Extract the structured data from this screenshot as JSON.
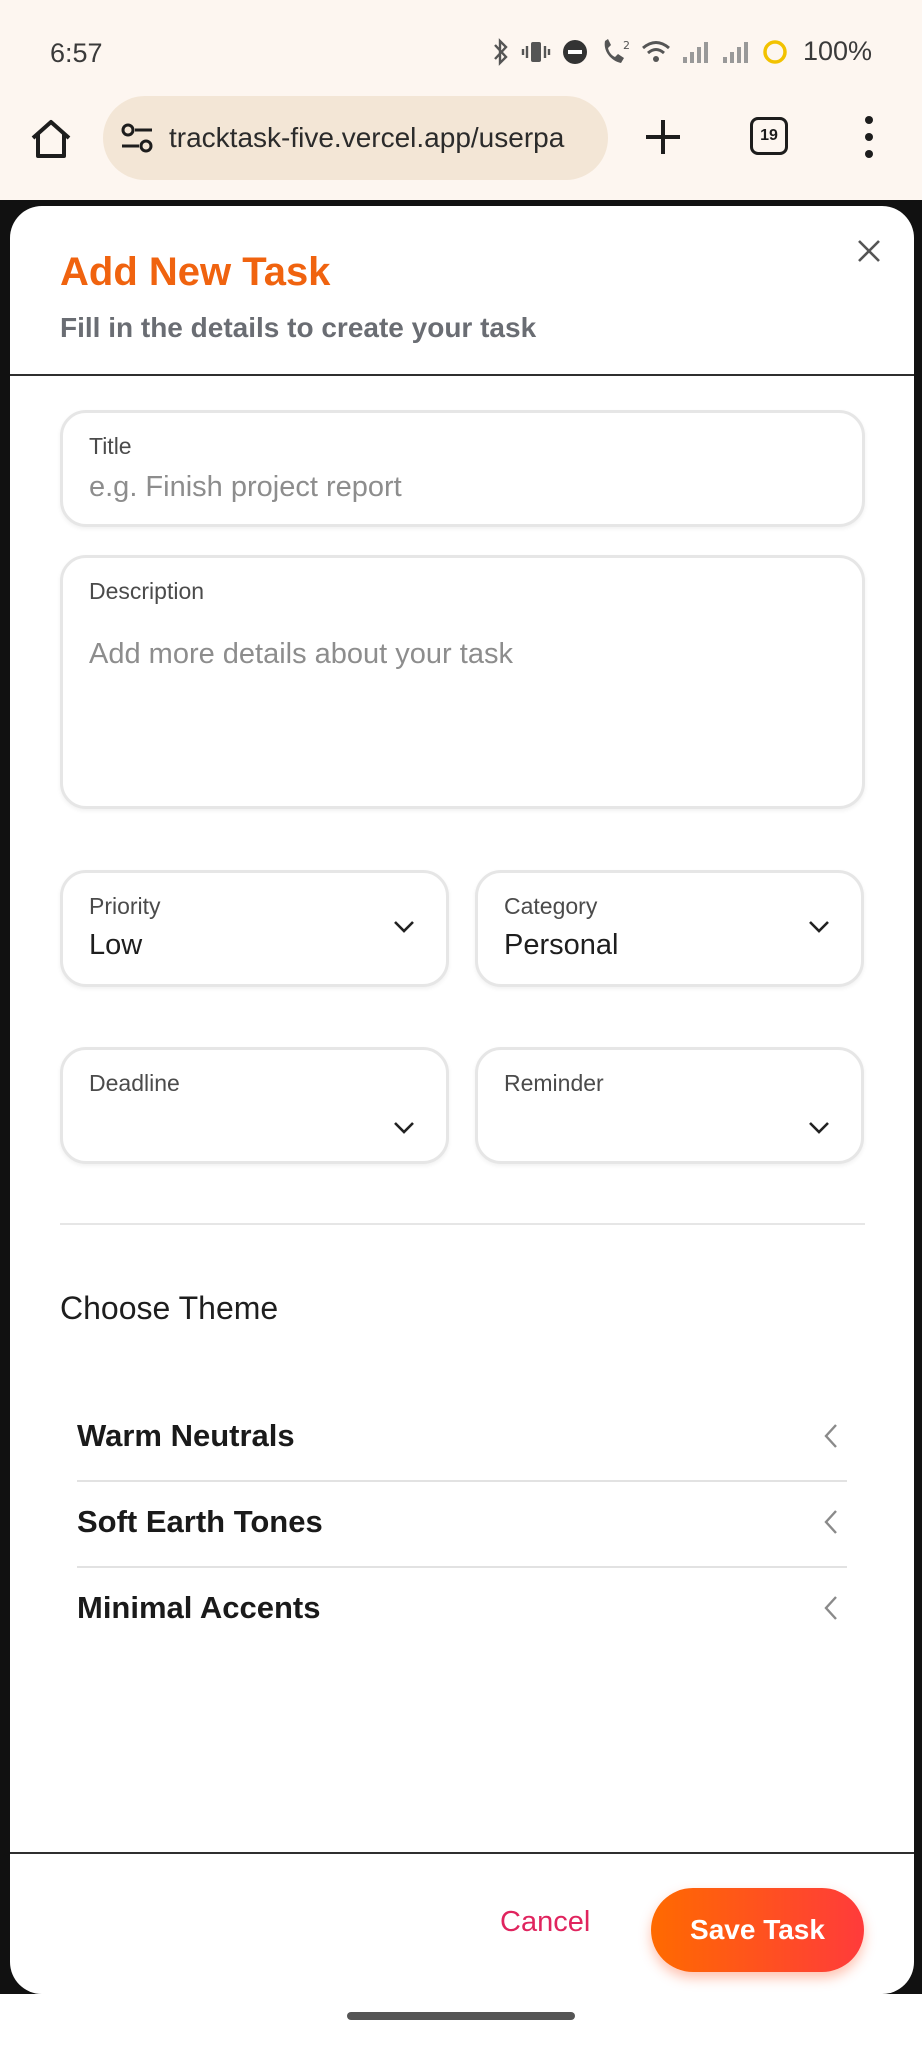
{
  "status_bar": {
    "time": "6:57",
    "battery": "100%",
    "icons": [
      "bluetooth-icon",
      "vibrate-icon",
      "dnd-icon",
      "call-icon",
      "wifi-icon",
      "signal-icon",
      "signal-icon",
      "battery-ring-icon"
    ]
  },
  "browser": {
    "url": "tracktask-five.vercel.app/userpa",
    "tab_count": "19",
    "icons": [
      "home-icon",
      "site-settings-icon",
      "new-tab-icon",
      "tab-switcher-icon",
      "more-menu-icon"
    ]
  },
  "modal": {
    "title": "Add New Task",
    "subtitle": "Fill in the details to create your task",
    "fields": {
      "title": {
        "label": "Title",
        "placeholder": "e.g. Finish project report"
      },
      "description": {
        "label": "Description",
        "placeholder": "Add more details about your task"
      },
      "priority": {
        "label": "Priority",
        "value": "Low"
      },
      "category": {
        "label": "Category",
        "value": "Personal"
      },
      "deadline": {
        "label": "Deadline",
        "value": ""
      },
      "reminder": {
        "label": "Reminder",
        "value": ""
      }
    },
    "theme": {
      "heading": "Choose Theme",
      "options": [
        "Warm Neutrals",
        "Soft Earth Tones",
        "Minimal Accents"
      ]
    },
    "footer": {
      "cancel_label": "Cancel",
      "save_label": "Save Task"
    }
  },
  "colors": {
    "accent": "#f0630f",
    "cancel": "#e0245e",
    "save_gradient": [
      "#ff6a00",
      "#ff3b3b"
    ]
  }
}
